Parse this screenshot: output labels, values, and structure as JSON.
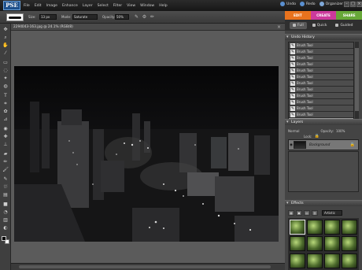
{
  "app": {
    "logo_text": "PSE",
    "menu": [
      "File",
      "Edit",
      "Image",
      "Enhance",
      "Layer",
      "Select",
      "Filter",
      "View",
      "Window",
      "Help"
    ],
    "mode_buttons": [
      "Undo",
      "Redo",
      "Organizer"
    ]
  },
  "options": {
    "size_label": "Size:",
    "size_value": "13 px",
    "mode_label": "Mode:",
    "mode_value": "Saturate",
    "opacity_label": "Opacity:",
    "opacity_value": "50%"
  },
  "tabs": {
    "edit": "EDIT",
    "create": "CREATE",
    "share": "SHARE",
    "sub": [
      "Full",
      "Quick",
      "Guided"
    ]
  },
  "document": {
    "title": "2294043-163.jpg @ 24.1% (RGB/8)"
  },
  "panels": {
    "undo_history_title": "Undo History",
    "undo_items": [
      "Brush Tool",
      "Brush Tool",
      "Brush Tool",
      "Brush Tool",
      "Brush Tool",
      "Brush Tool",
      "Brush Tool",
      "Brush Tool",
      "Brush Tool",
      "Brush Tool",
      "Brush Tool",
      "Brush Tool",
      "Brush Tool"
    ],
    "layers_title": "Layers",
    "blend_mode": "Normal",
    "opacity_label": "Opacity:",
    "opacity_value": "100%",
    "lock_label": "Lock:",
    "layer_name": "Background",
    "effects_title": "Effects",
    "effects_filter": "Artistic"
  },
  "colors": {
    "edit_tab": "#e8731e",
    "create_tab": "#cc3a9c",
    "share_tab": "#67a838"
  }
}
